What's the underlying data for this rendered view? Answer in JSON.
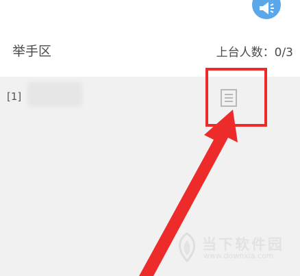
{
  "raise_hand_area": {
    "title": "举手区",
    "podium_count_label": "上台人数：0/3"
  },
  "participants": [
    {
      "index": "[1]",
      "name": ""
    }
  ],
  "icons": {
    "announce": "megaphone-icon",
    "row_action": "document-icon"
  },
  "watermark": {
    "brand_name": "当下软件园",
    "url": "www.downxia.com"
  },
  "annotation": {
    "highlight_color": "#ee2b2b"
  }
}
